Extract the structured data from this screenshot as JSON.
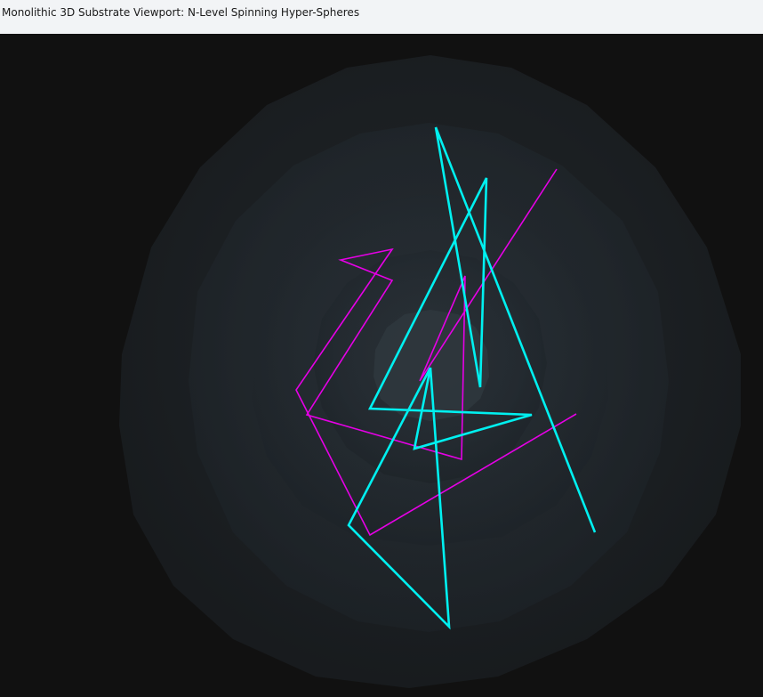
{
  "window": {
    "title": "Monolithic 3D Substrate Viewport: N-Level Spinning Hyper-Spheres"
  },
  "viewport": {
    "background_color": "#111111",
    "sphere_levels": 5,
    "sphere_fill_color": "#262d33",
    "polyline_colors": {
      "cyan": "#00f0f0",
      "magenta": "#e600e6"
    }
  }
}
